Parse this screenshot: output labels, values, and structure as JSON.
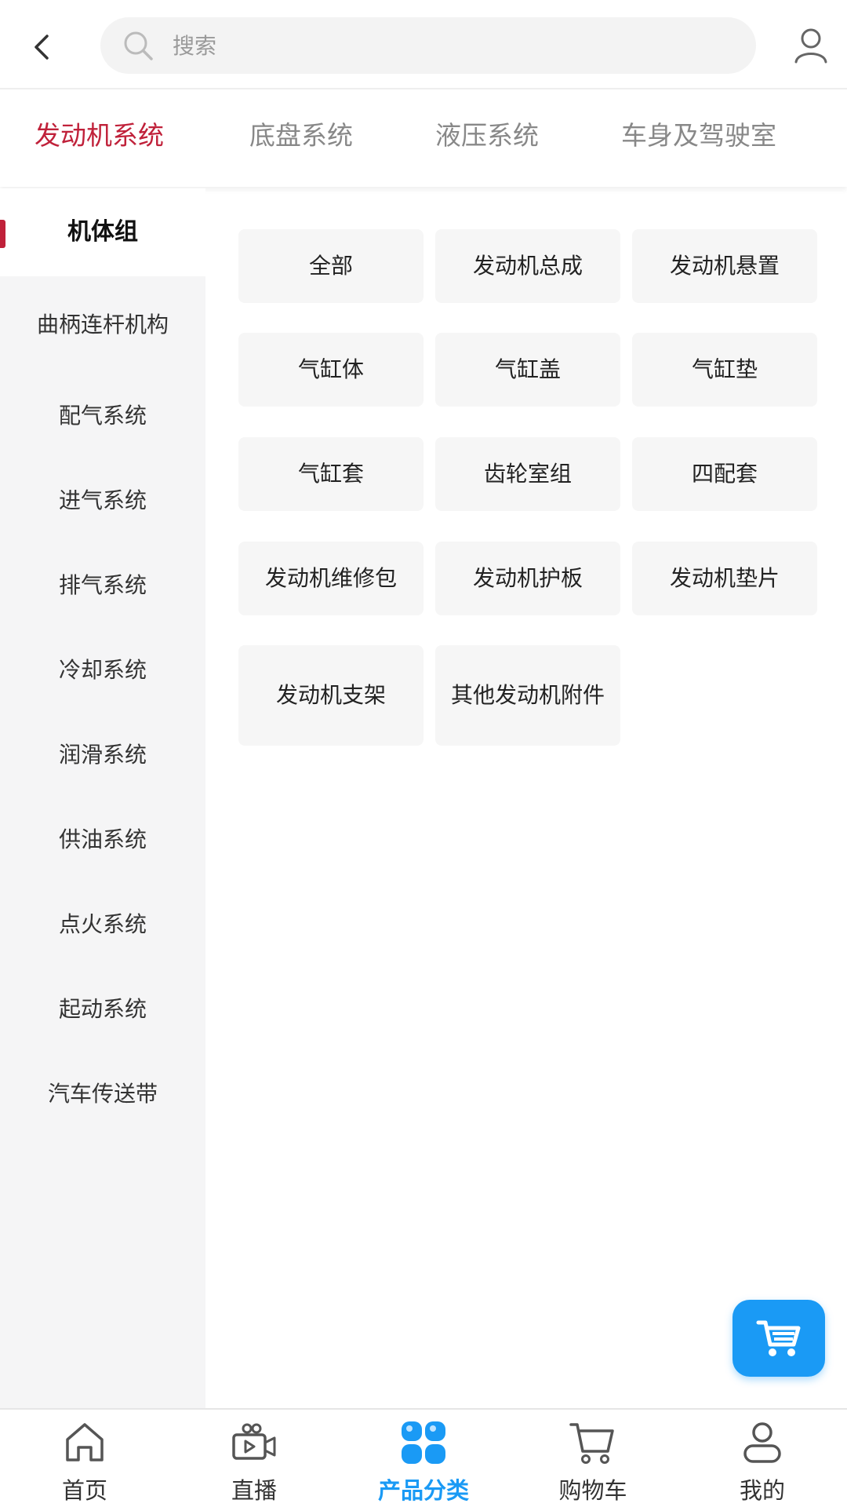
{
  "header": {
    "search_placeholder": "搜索"
  },
  "tabs": [
    {
      "label": "发动机系统",
      "active": true
    },
    {
      "label": "底盘系统",
      "active": false
    },
    {
      "label": "液压系统",
      "active": false
    },
    {
      "label": "车身及驾驶室",
      "active": false
    }
  ],
  "sidebar": {
    "items": [
      {
        "label": "机体组",
        "active": true
      },
      {
        "label": "曲柄连杆机构"
      },
      {
        "label": "配气系统"
      },
      {
        "label": "进气系统"
      },
      {
        "label": "排气系统"
      },
      {
        "label": "冷却系统"
      },
      {
        "label": "润滑系统"
      },
      {
        "label": "供油系统"
      },
      {
        "label": "点火系统"
      },
      {
        "label": "起动系统"
      },
      {
        "label": "汽车传送带"
      }
    ]
  },
  "grid": {
    "items": [
      {
        "label": "全部"
      },
      {
        "label": "发动机总成"
      },
      {
        "label": "发动机悬置"
      },
      {
        "label": "气缸体"
      },
      {
        "label": "气缸盖"
      },
      {
        "label": "气缸垫"
      },
      {
        "label": "气缸套"
      },
      {
        "label": "齿轮室组"
      },
      {
        "label": "四配套"
      },
      {
        "label": "发动机维修包"
      },
      {
        "label": "发动机护板"
      },
      {
        "label": "发动机垫片"
      },
      {
        "label": "发动机支架"
      },
      {
        "label": "其他发动机附件"
      }
    ]
  },
  "bottom_nav": [
    {
      "label": "首页",
      "icon": "home-icon"
    },
    {
      "label": "直播",
      "icon": "video-camera-icon"
    },
    {
      "label": "产品分类",
      "icon": "category-grid-icon",
      "active": true
    },
    {
      "label": "购物车",
      "icon": "cart-icon"
    },
    {
      "label": "我的",
      "icon": "user-icon"
    }
  ],
  "colors": {
    "accent_red": "#c0213a",
    "accent_blue": "#1a9af5",
    "sidebar_bg": "#f5f5f6",
    "tile_bg": "#f6f6f6"
  }
}
